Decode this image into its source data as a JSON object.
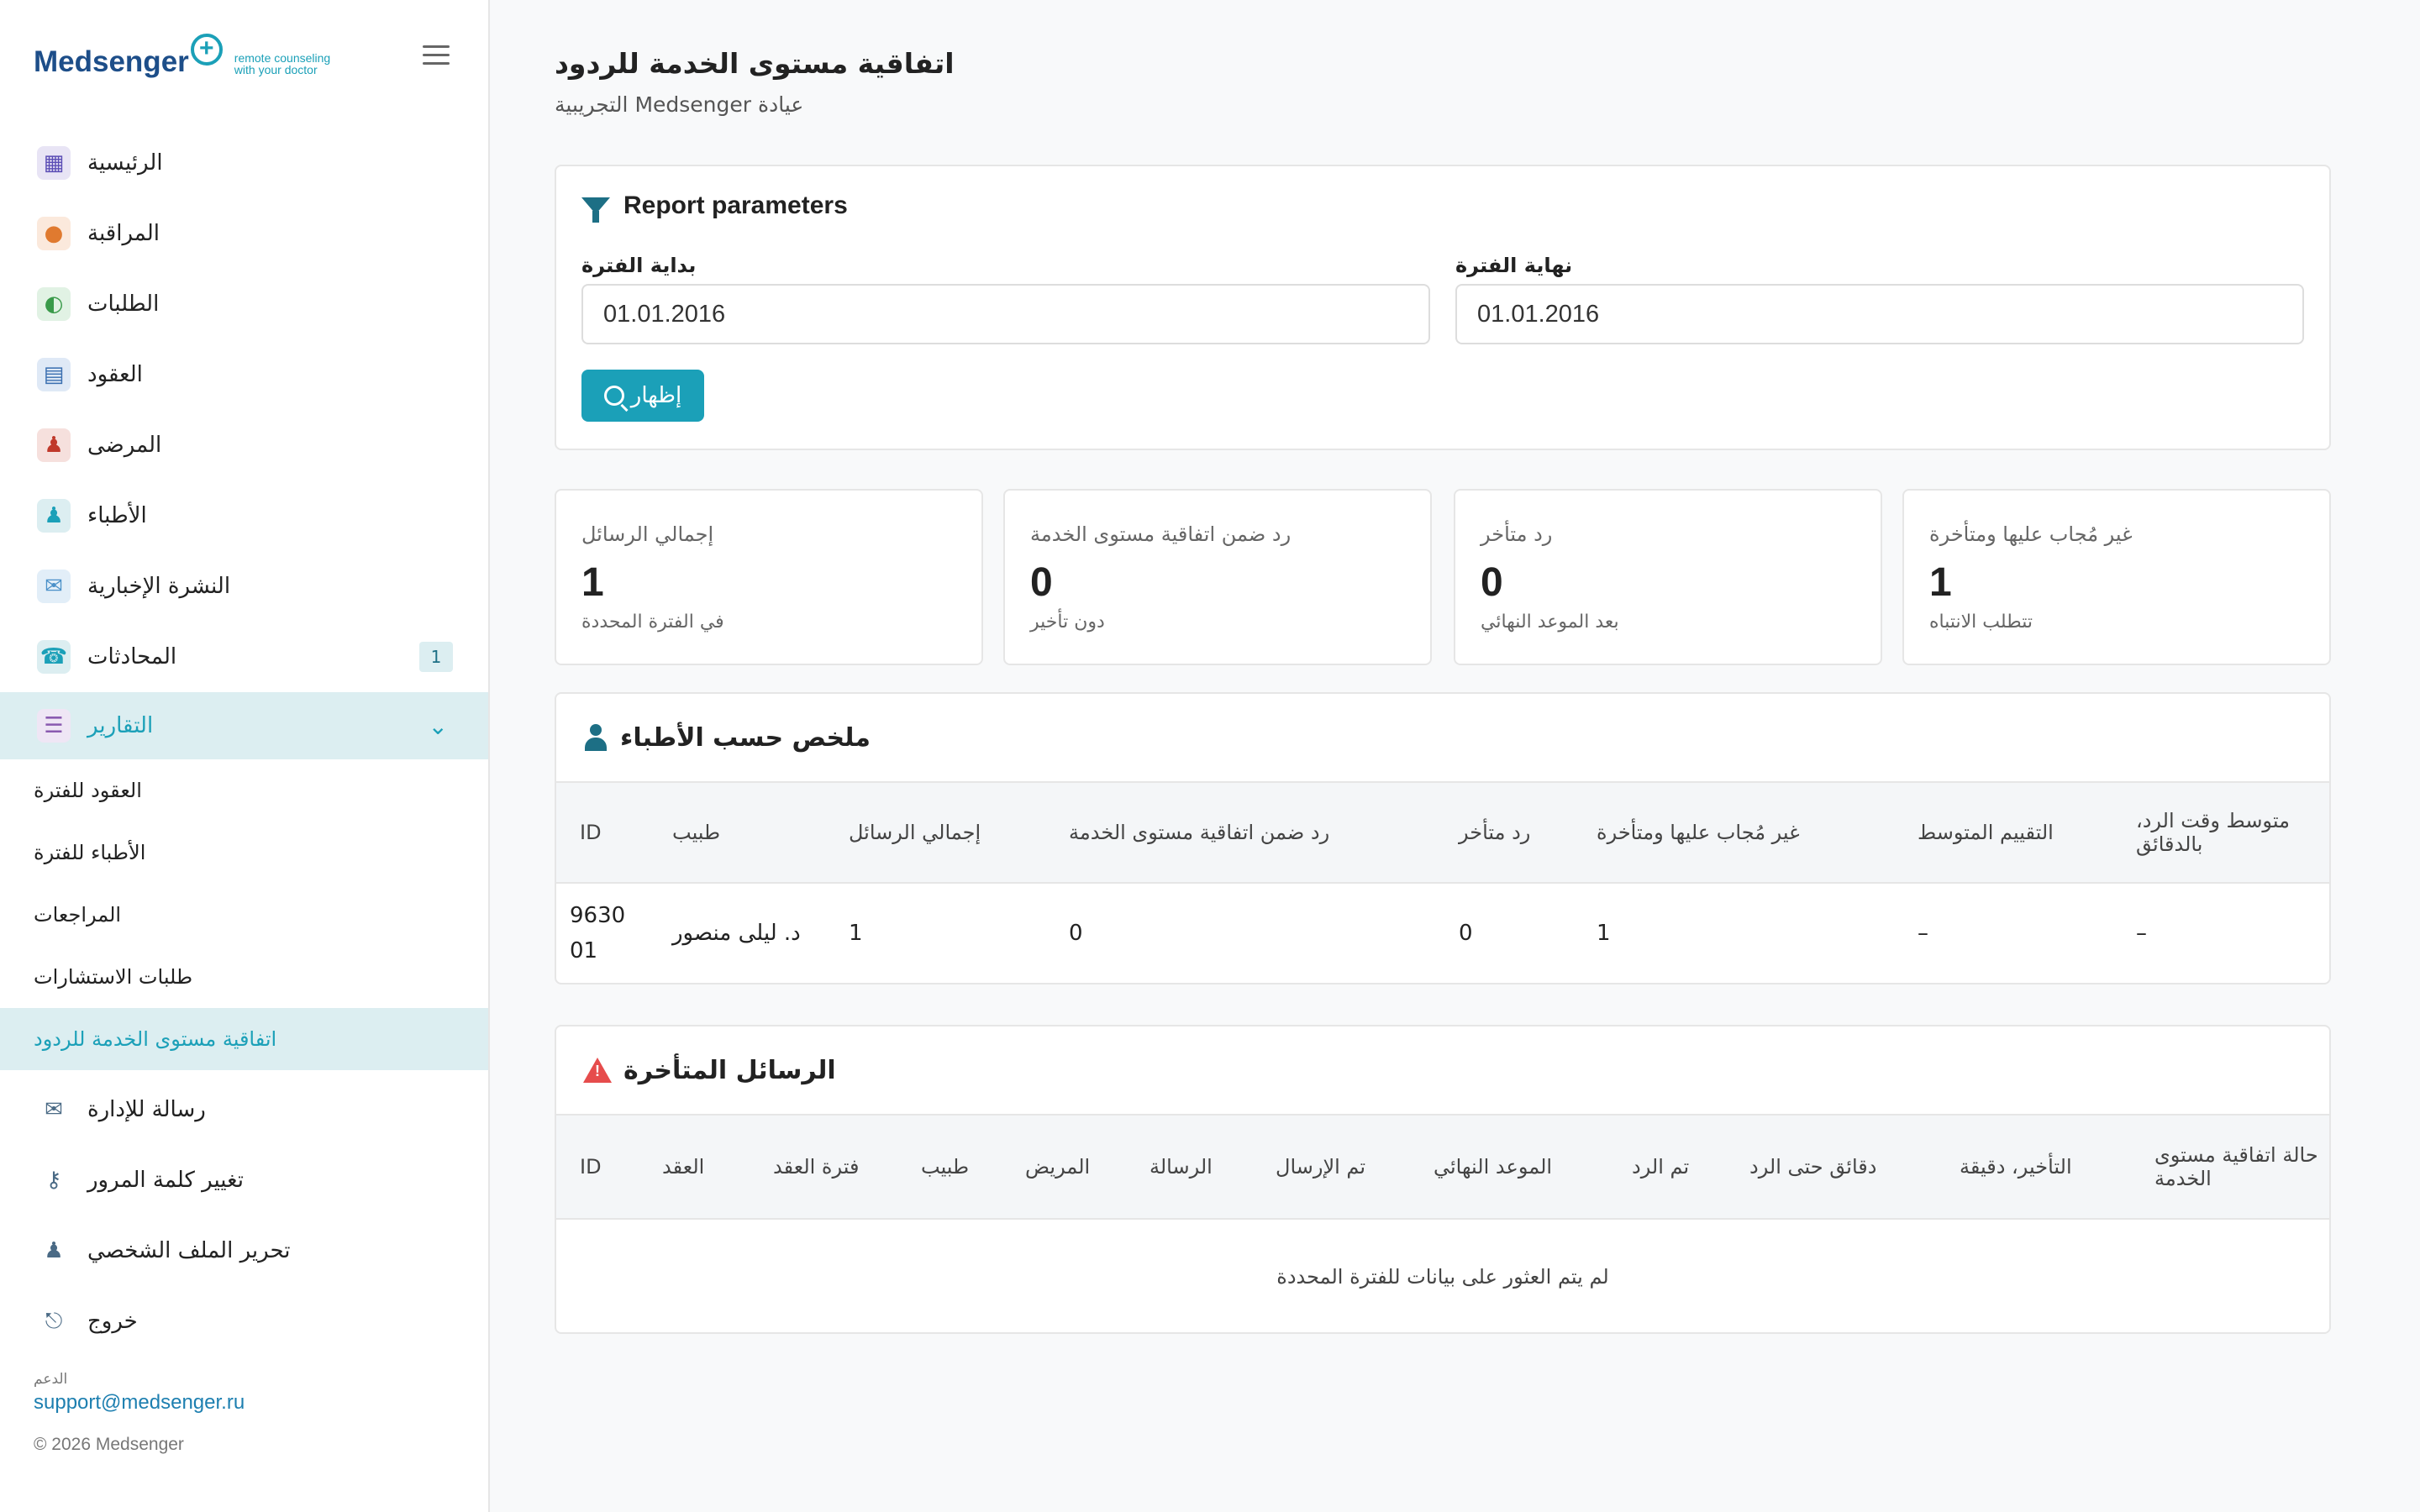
{
  "brand": {
    "name": "Medsenger",
    "tagline_line1": "remote counseling",
    "tagline_line2": "with your doctor"
  },
  "nav": {
    "items": [
      {
        "label": "الرئيسية",
        "icon": "hospital-icon",
        "color": "#5b4db5"
      },
      {
        "label": "المراقبة",
        "icon": "doctor-icon",
        "color": "#e07a2f"
      },
      {
        "label": "الطلبات",
        "icon": "user-search-icon",
        "color": "#3a9a4a"
      },
      {
        "label": "العقود",
        "icon": "contract-icon",
        "color": "#3a6fb0"
      },
      {
        "label": "المرضى",
        "icon": "patients-icon",
        "color": "#c0392b"
      },
      {
        "label": "الأطباء",
        "icon": "doctors-icon",
        "color": "#1ba0b8"
      },
      {
        "label": "النشرة الإخبارية",
        "icon": "mail-icon",
        "color": "#4a90c8"
      },
      {
        "label": "المحادثات",
        "icon": "phone-icon",
        "color": "#1ba0b8",
        "badge": "1"
      }
    ],
    "reports": {
      "label": "التقارير",
      "icon": "report-icon"
    },
    "sub_items": [
      "العقود للفترة",
      "الأطباء للفترة",
      "المراجعات",
      "طلبات الاستشارات",
      "اتفاقية مستوى الخدمة للردود"
    ],
    "bottom_items": [
      {
        "label": "رسالة للإدارة",
        "icon": "envelope-icon"
      },
      {
        "label": "تغيير كلمة المرور",
        "icon": "key-icon"
      },
      {
        "label": "تحرير الملف الشخصي",
        "icon": "user-edit-icon"
      },
      {
        "label": "خروج",
        "icon": "exit-icon"
      }
    ]
  },
  "support": {
    "label": "الدعم",
    "email": "support@medsenger.ru"
  },
  "copyright": "© 2026 Medsenger",
  "page": {
    "title": "اتفاقية مستوى الخدمة للردود",
    "subtitle": "التجريبية Medsenger عيادة"
  },
  "params": {
    "title": "Report parameters",
    "start_label": "بداية الفترة",
    "start_value": "01.01.2016",
    "end_label": "نهاية الفترة",
    "end_value": "01.01.2016",
    "show_button": "إظهار"
  },
  "stats": [
    {
      "title": "إجمالي الرسائل",
      "value": "1",
      "sub": "في الفترة المحددة"
    },
    {
      "title": "رد ضمن اتفاقية مستوى الخدمة",
      "value": "0",
      "sub": "دون تأخير"
    },
    {
      "title": "رد متأخر",
      "value": "0",
      "sub": "بعد الموعد النهائي"
    },
    {
      "title": "غير مُجاب عليها ومتأخرة",
      "value": "1",
      "sub": "تتطلب الانتباه"
    }
  ],
  "doctors_summary": {
    "title": "ملخص حسب الأطباء",
    "columns": [
      "ID",
      "طبيب",
      "إجمالي الرسائل",
      "رد ضمن اتفاقية مستوى الخدمة",
      "رد متأخر",
      "غير مُجاب عليها ومتأخرة",
      "التقييم المتوسط",
      "متوسط وقت الرد، بالدقائق"
    ],
    "rows": [
      [
        "963001",
        "د. ليلى منصور",
        "1",
        "0",
        "0",
        "1",
        "–",
        "–"
      ]
    ]
  },
  "late_messages": {
    "title": "الرسائل المتأخرة",
    "columns": [
      "ID",
      "العقد",
      "فترة العقد",
      "طبيب",
      "المريض",
      "الرسالة",
      "تم الإرسال",
      "الموعد النهائي",
      "تم الرد",
      "دقائق حتى الرد",
      "التأخير، دقيقة",
      "حالة اتفاقية مستوى الخدمة"
    ],
    "empty_text": "لم يتم العثور على بيانات للفترة المحددة"
  }
}
